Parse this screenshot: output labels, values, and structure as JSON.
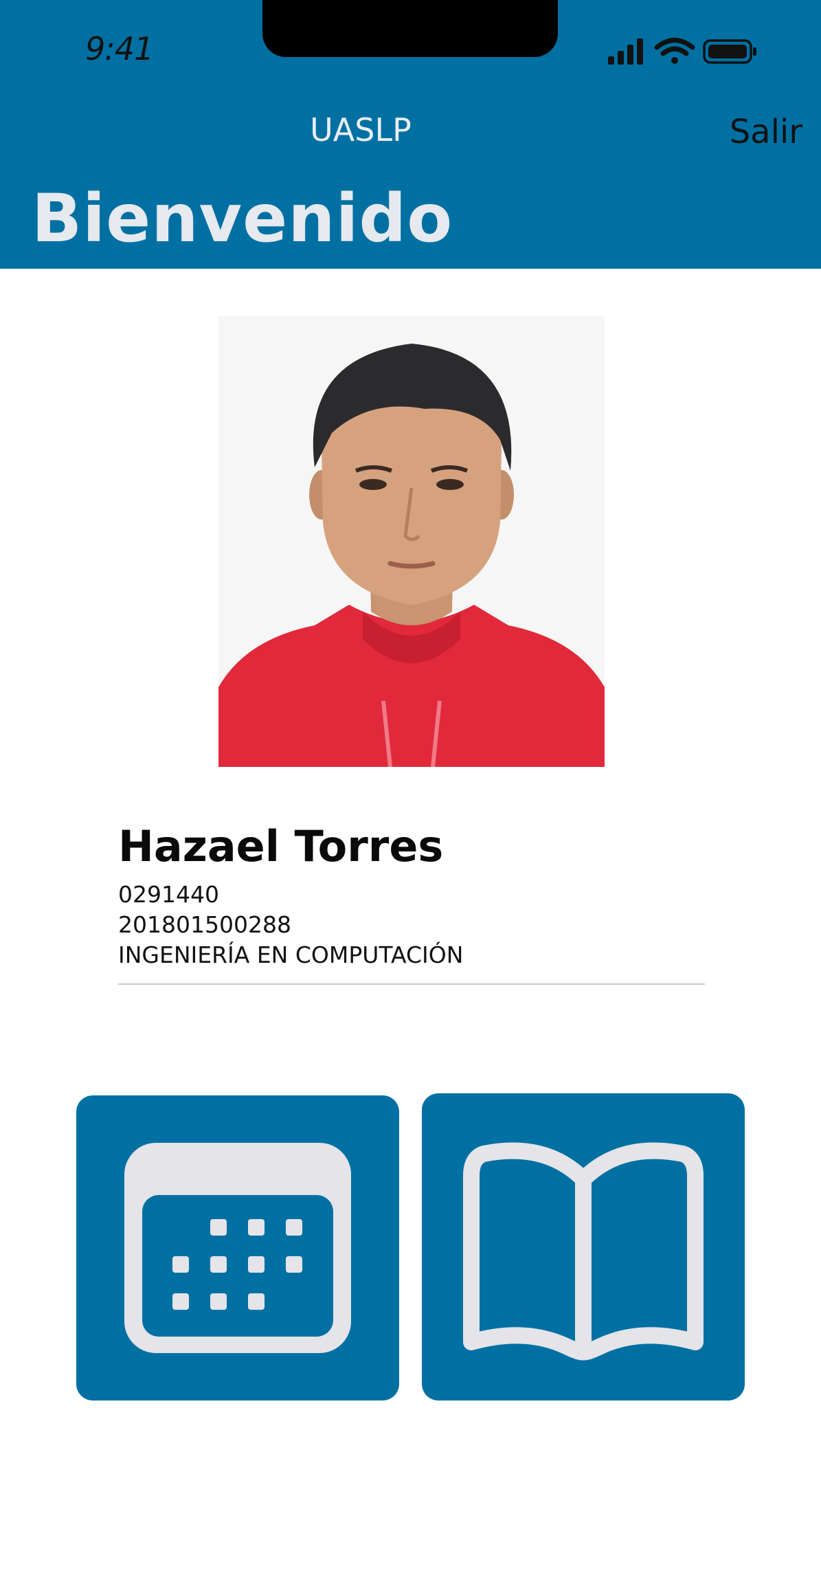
{
  "status_bar": {
    "time": "9:41",
    "icons": [
      "cellular-signal-icon",
      "wifi-icon",
      "battery-icon"
    ]
  },
  "nav": {
    "title": "UASLP",
    "exit_label": "Salir",
    "large_title": "Bienvenido"
  },
  "profile": {
    "photo_icon": "student-photo",
    "name": "Hazael Torres",
    "lines": [
      "0291440",
      "201801500288",
      "INGENIERÍA EN COMPUTACIÓN"
    ]
  },
  "tiles": [
    {
      "icon": "calendar-icon"
    },
    {
      "icon": "book-icon"
    }
  ],
  "colors": {
    "primary": "#0070a3",
    "icon_fill": "#e4e4e9",
    "title_text": "#e6e9ee",
    "background": "#ffffff"
  }
}
